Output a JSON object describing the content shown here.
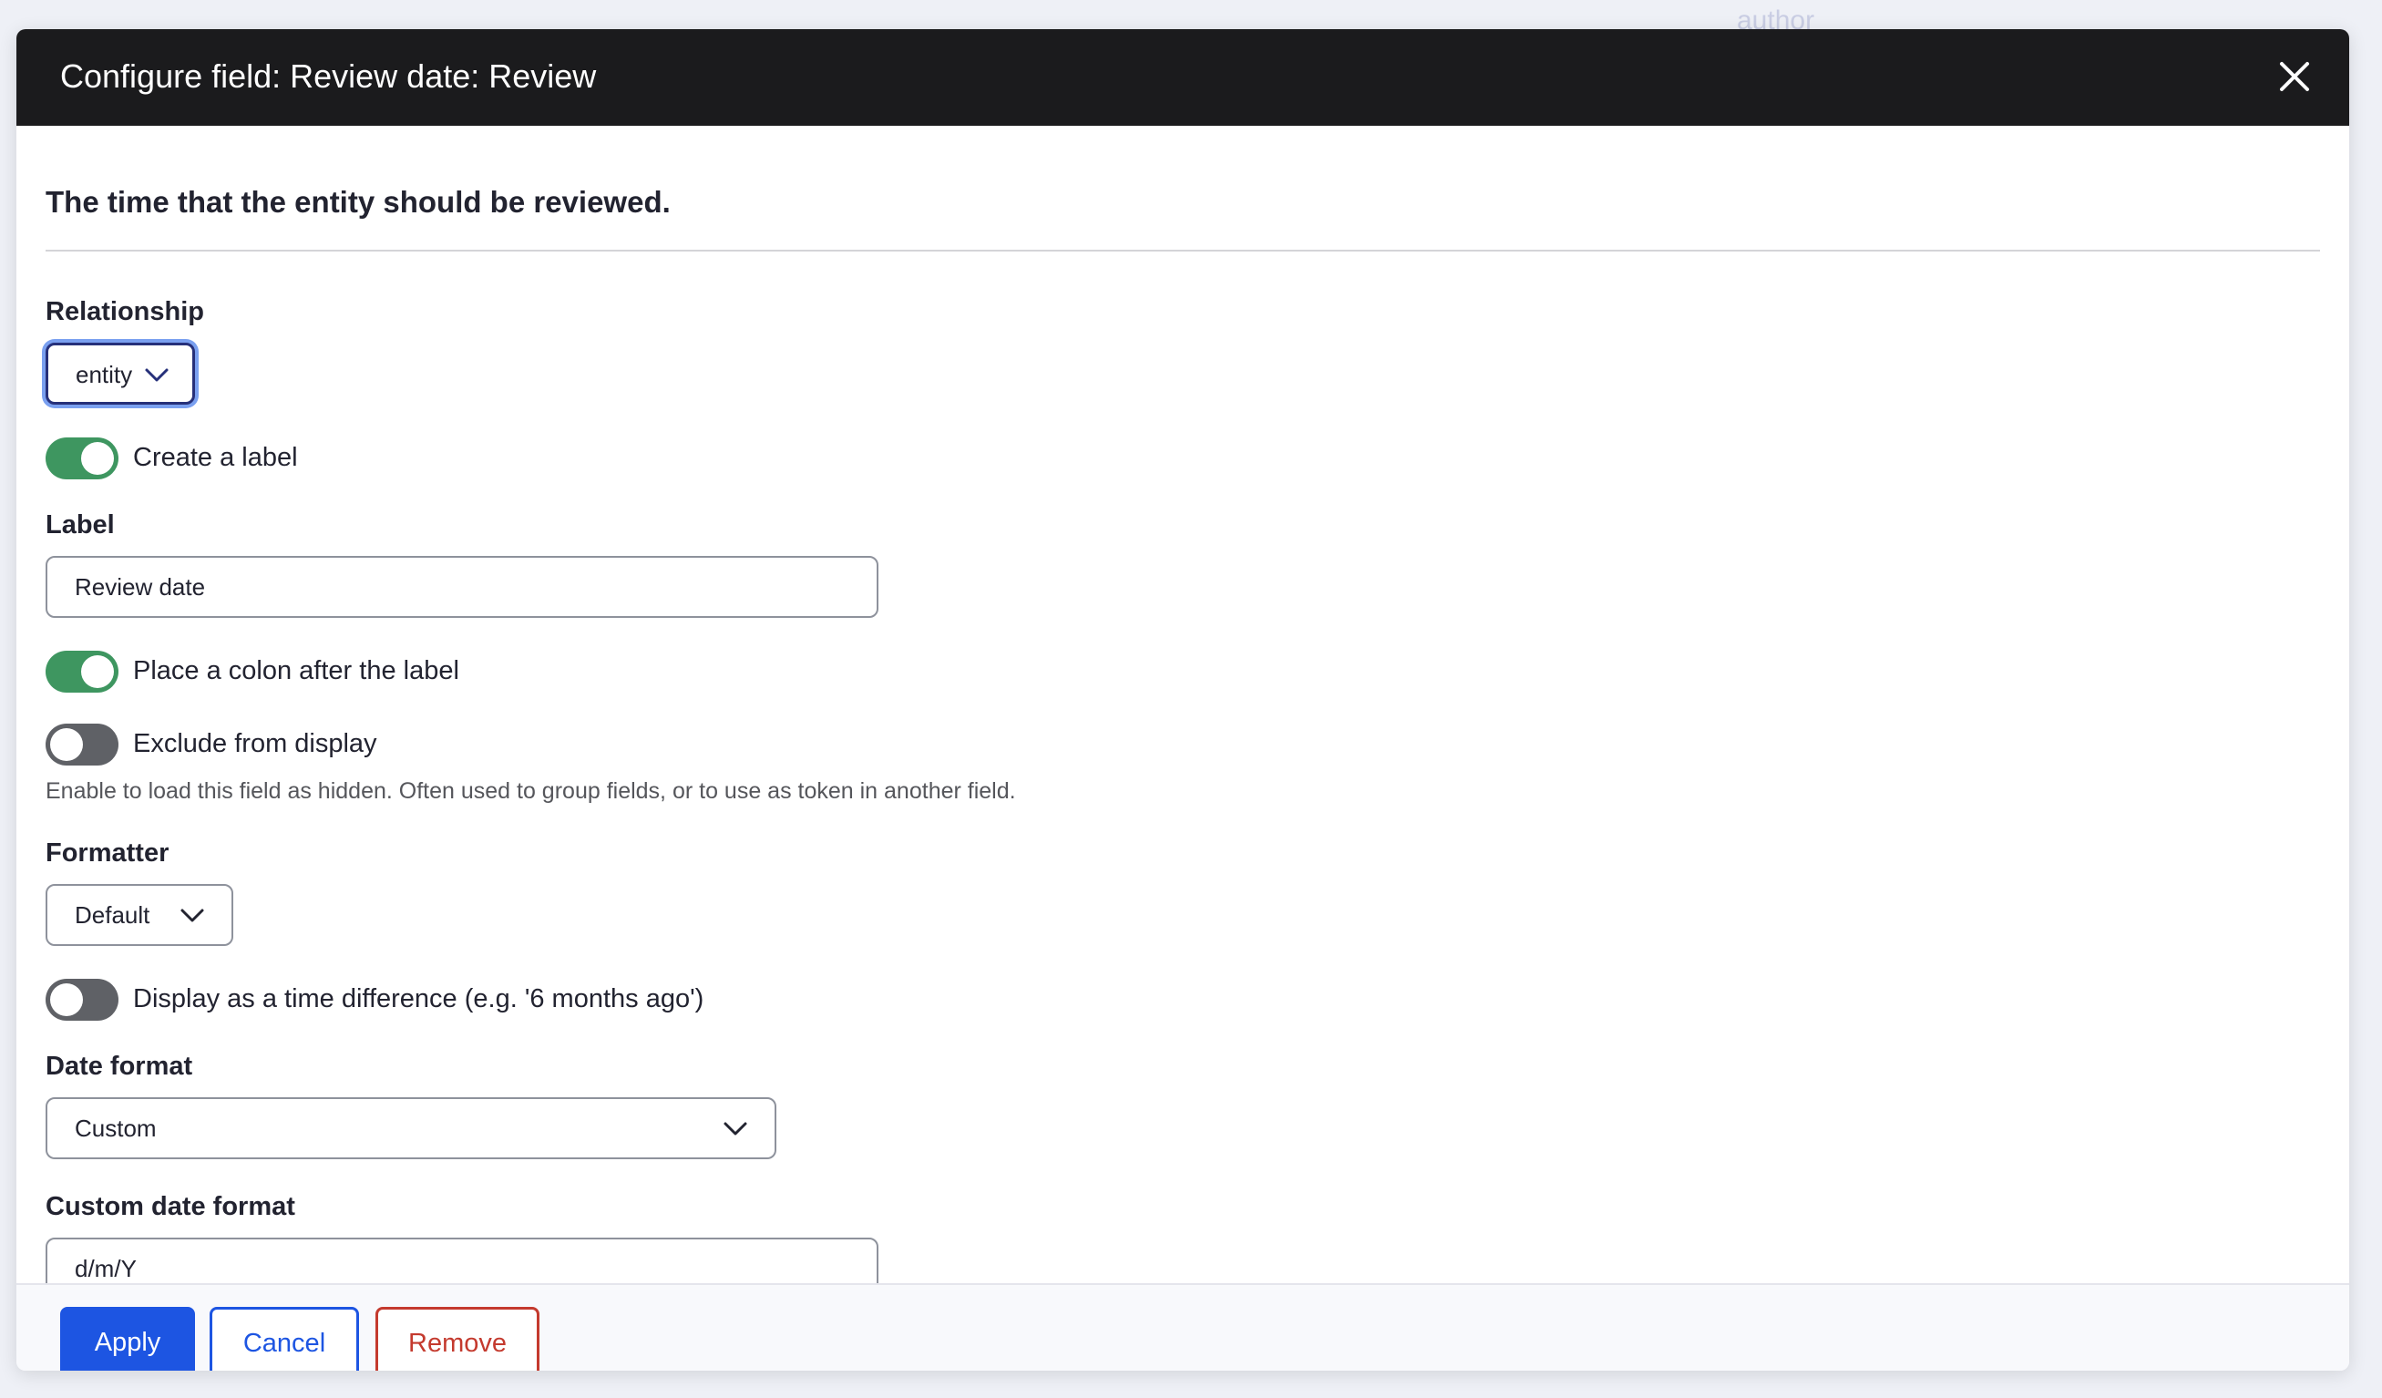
{
  "background": {
    "partial_text": "author"
  },
  "dialog": {
    "title": "Configure field: Review date: Review",
    "description": "The time that the entity should be reviewed.",
    "relationship": {
      "label": "Relationship",
      "value": "entity"
    },
    "create_label": {
      "label": "Create a label",
      "enabled": true
    },
    "label_field": {
      "label": "Label",
      "value": "Review date"
    },
    "place_colon": {
      "label": "Place a colon after the label",
      "enabled": true
    },
    "exclude_display": {
      "label": "Exclude from display",
      "enabled": false,
      "help": "Enable to load this field as hidden. Often used to group fields, or to use as token in another field."
    },
    "formatter": {
      "label": "Formatter",
      "value": "Default"
    },
    "time_difference": {
      "label": "Display as a time difference (e.g. '6 months ago')",
      "enabled": false
    },
    "date_format": {
      "label": "Date format",
      "value": "Custom"
    },
    "custom_date_format": {
      "label": "Custom date format",
      "value": "d/m/Y"
    }
  },
  "footer": {
    "apply_label": "Apply",
    "cancel_label": "Cancel",
    "remove_label": "Remove"
  },
  "colors": {
    "titlebar": "#1b1b1d",
    "primary": "#1d55e2",
    "danger": "#c43a2e",
    "toggle_on": "#3e9660",
    "toggle_off": "#5f6166"
  },
  "icons": {
    "close": "close-icon",
    "chevron": "chevron-down-icon"
  }
}
